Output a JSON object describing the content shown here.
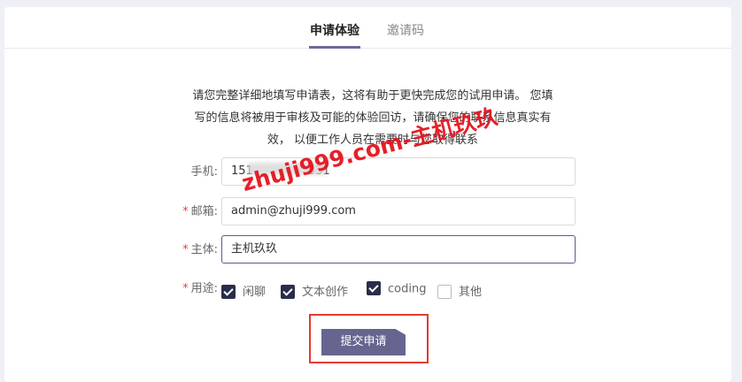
{
  "tabs": [
    {
      "label": "申请体验",
      "active": true
    },
    {
      "label": "邀请码",
      "active": false
    }
  ],
  "intro": {
    "line1": "请您完整详细地填写申请表，这将有助于更快完成您的试用申请。 您填",
    "line2": "写的信息将被用于审核及可能的体验回访，请确保您的联系信息真实有",
    "line3": "效， 以便工作人员在需要时与您取得联系"
  },
  "form": {
    "phone": {
      "label": "手机:",
      "value": "151",
      "value_tail": "031",
      "required": false
    },
    "email": {
      "label": "邮箱:",
      "value": "admin@zhuji999.com",
      "required": true,
      "required_mark": "*"
    },
    "entity": {
      "label": "主体:",
      "value": "主机玖玖",
      "required": true,
      "required_mark": "*"
    },
    "usage": {
      "label": "用途:",
      "required": true,
      "required_mark": "*",
      "options": [
        {
          "label": "闲聊",
          "checked": true
        },
        {
          "label": "文本创作",
          "checked": true
        },
        {
          "label": "coding",
          "checked": true
        },
        {
          "label": "其他",
          "checked": false
        }
      ]
    }
  },
  "submit_label": "提交申请",
  "watermark": "zhuji999.com-主机玖玖",
  "colors": {
    "accent": "#66658f",
    "required": "#e0463f",
    "highlight": "#e23b30",
    "watermark": "#e5141e"
  }
}
